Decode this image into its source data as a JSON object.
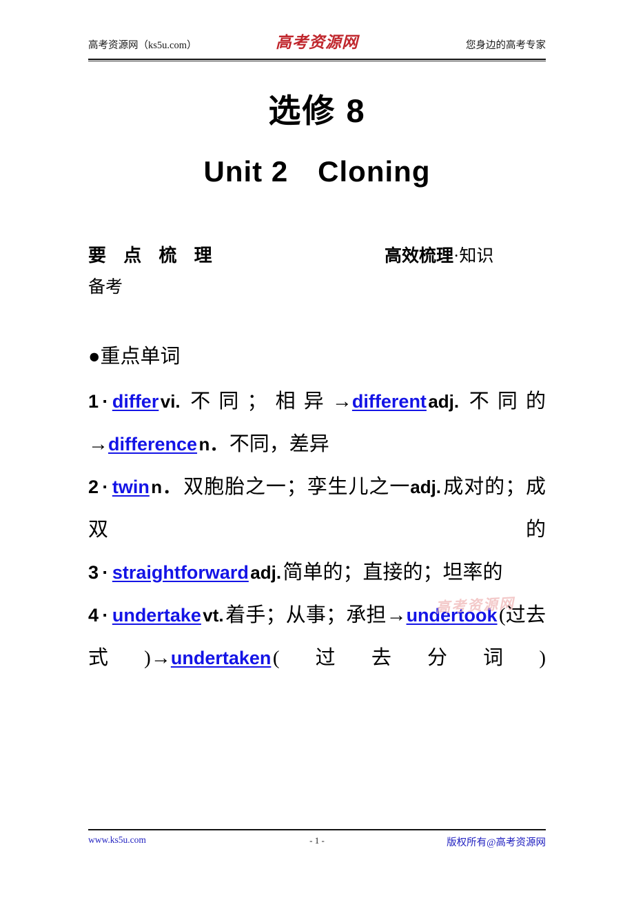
{
  "header": {
    "left_text": "高考资源网（ks5u.com）",
    "logo_text": "高考资源网",
    "right_text": "您身边的高考专家"
  },
  "title": {
    "main": "选修 8",
    "sub": "Unit 2　Cloning"
  },
  "section": {
    "band_title": "要 点 梳 理",
    "band_sub_strong": "高效梳理",
    "band_sub_light": "·知识",
    "band_sub_wrap": "备考"
  },
  "body": {
    "bullet_heading": "●重点单词",
    "entries": [
      {
        "num": "1",
        "sep": "·",
        "parts": [
          {
            "type": "kw",
            "text": "differ"
          },
          {
            "type": "pos",
            "text": "vi."
          },
          {
            "type": "cn",
            "text": "不同；相异"
          },
          {
            "type": "arrow",
            "text": "→"
          },
          {
            "type": "kw",
            "text": "different"
          },
          {
            "type": "pos",
            "text": "adj."
          },
          {
            "type": "cn",
            "text": "不同的"
          },
          {
            "type": "arrow",
            "text": "→"
          },
          {
            "type": "kw",
            "text": "difference"
          },
          {
            "type": "pos",
            "text": "n．"
          },
          {
            "type": "cn",
            "text": "不同，差异"
          }
        ]
      },
      {
        "num": "2",
        "sep": "·",
        "parts": [
          {
            "type": "kw",
            "text": "twin"
          },
          {
            "type": "pos",
            "text": "n．"
          },
          {
            "type": "cn",
            "text": "双胞胎之一；孪生儿之一"
          },
          {
            "type": "pos",
            "text": "adj."
          },
          {
            "type": "cn",
            "text": "成对的；成双的"
          }
        ]
      },
      {
        "num": "3",
        "sep": "·",
        "parts": [
          {
            "type": "kw",
            "text": "straightforward"
          },
          {
            "type": "pos",
            "text": "adj."
          },
          {
            "type": "cn",
            "text": "简单的；直接的；坦率的"
          }
        ]
      },
      {
        "num": "4",
        "sep": "·",
        "parts": [
          {
            "type": "kw",
            "text": "undertake"
          },
          {
            "type": "pos",
            "text": "vt."
          },
          {
            "type": "cn",
            "text": "着手；从事；承担"
          },
          {
            "type": "arrow",
            "text": "→"
          },
          {
            "type": "kw",
            "text": "undertook"
          },
          {
            "type": "cn",
            "text": "(过去式)"
          },
          {
            "type": "arrow",
            "text": "→"
          },
          {
            "type": "kw",
            "text": "undertaken"
          },
          {
            "type": "cn",
            "text": "(过去分词)"
          }
        ]
      }
    ]
  },
  "watermark": {
    "text": "高考资源网"
  },
  "footer": {
    "left_text": "www.ks5u.com",
    "page_number": "- 1 -",
    "right_text": "版权所有@高考资源网"
  }
}
